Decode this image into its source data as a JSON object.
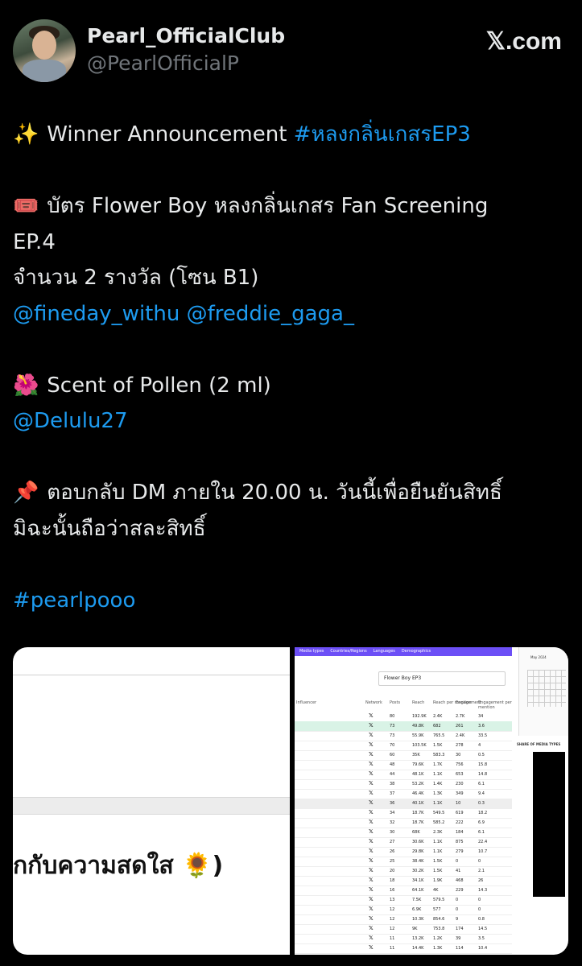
{
  "header": {
    "display_name": "Pearl_OfficialClub",
    "handle": "@PearlOfficialP",
    "site": "𝕏.com"
  },
  "tweet": {
    "line1_emoji": "✨",
    "line1_text": " Winner Announcement ",
    "line1_tag": "#หลงกลิ่นเกสรEP3",
    "line2_emoji": "🎟️",
    "line2_text": " บัตร Flower Boy หลงกลิ่นเกสร Fan Screening",
    "line3_text": "EP.4",
    "line4_text": "จำนวน 2 รางวัล (โซน B1)",
    "line5_mentions": "@fineday_withu @freddie_gaga_",
    "line6_emoji": "🌺",
    "line6_text": " Scent of Pollen (2 ml)",
    "line7_mention": "@Delulu27",
    "line8_emoji": "📌",
    "line8_text": " ตอบกลับ DM ภายใน 20.00 น. วันนี้เพื่อยืนยันสิทธิ์",
    "line9_text": "มิฉะนั้นถือว่าสละสิทธิ์",
    "line10_tag": "#pearlpooo"
  },
  "media": {
    "left_text": "กกับความสดใส 🌻)",
    "right_tabs": [
      "Media types",
      "Countries/Regions",
      "Languages",
      "Demographics"
    ],
    "right_select": "Flower Boy EP3",
    "right_columns": [
      "Influencer",
      "Network",
      "Posts",
      "Reach",
      "Reach per mention",
      "Engagement",
      "Engagement per mention"
    ],
    "right_rows": [
      [
        "80",
        "192.9K",
        "2.4K",
        "2.7K",
        "34"
      ],
      [
        "73",
        "49.8K",
        "682",
        "261",
        "3.6"
      ],
      [
        "73",
        "55.9K",
        "765.5",
        "2.4K",
        "33.5"
      ],
      [
        "70",
        "103.5K",
        "1.5K",
        "278",
        "4"
      ],
      [
        "60",
        "35K",
        "583.3",
        "30",
        "0.5"
      ],
      [
        "48",
        "79.6K",
        "1.7K",
        "756",
        "15.8"
      ],
      [
        "44",
        "48.1K",
        "1.1K",
        "653",
        "14.8"
      ],
      [
        "38",
        "53.2K",
        "1.4K",
        "230",
        "6.1"
      ],
      [
        "37",
        "46.4K",
        "1.3K",
        "349",
        "9.4"
      ],
      [
        "36",
        "40.1K",
        "1.1K",
        "10",
        "0.3"
      ],
      [
        "34",
        "18.7K",
        "549.5",
        "619",
        "18.2"
      ],
      [
        "32",
        "18.7K",
        "585.2",
        "222",
        "6.9"
      ],
      [
        "30",
        "68K",
        "2.3K",
        "184",
        "6.1"
      ],
      [
        "27",
        "30.6K",
        "1.1K",
        "875",
        "22.4"
      ],
      [
        "26",
        "29.8K",
        "1.1K",
        "279",
        "10.7"
      ],
      [
        "25",
        "38.4K",
        "1.5K",
        "0",
        "0"
      ],
      [
        "20",
        "30.2K",
        "1.5K",
        "41",
        "2.1"
      ],
      [
        "18",
        "34.1K",
        "1.9K",
        "468",
        "26"
      ],
      [
        "16",
        "64.1K",
        "4K",
        "229",
        "14.3"
      ],
      [
        "13",
        "7.5K",
        "579.5",
        "0",
        "0"
      ],
      [
        "12",
        "6.9K",
        "577",
        "0",
        "0"
      ],
      [
        "12",
        "10.3K",
        "854.6",
        "9",
        "0.8"
      ],
      [
        "12",
        "9K",
        "753.8",
        "174",
        "14.5"
      ],
      [
        "11",
        "13.2K",
        "1.2K",
        "39",
        "3.5"
      ],
      [
        "11",
        "14.4K",
        "1.3K",
        "114",
        "10.4"
      ]
    ],
    "calendar_month": "May 2024",
    "share_label": "SHARE OF MEDIA TYPES"
  }
}
